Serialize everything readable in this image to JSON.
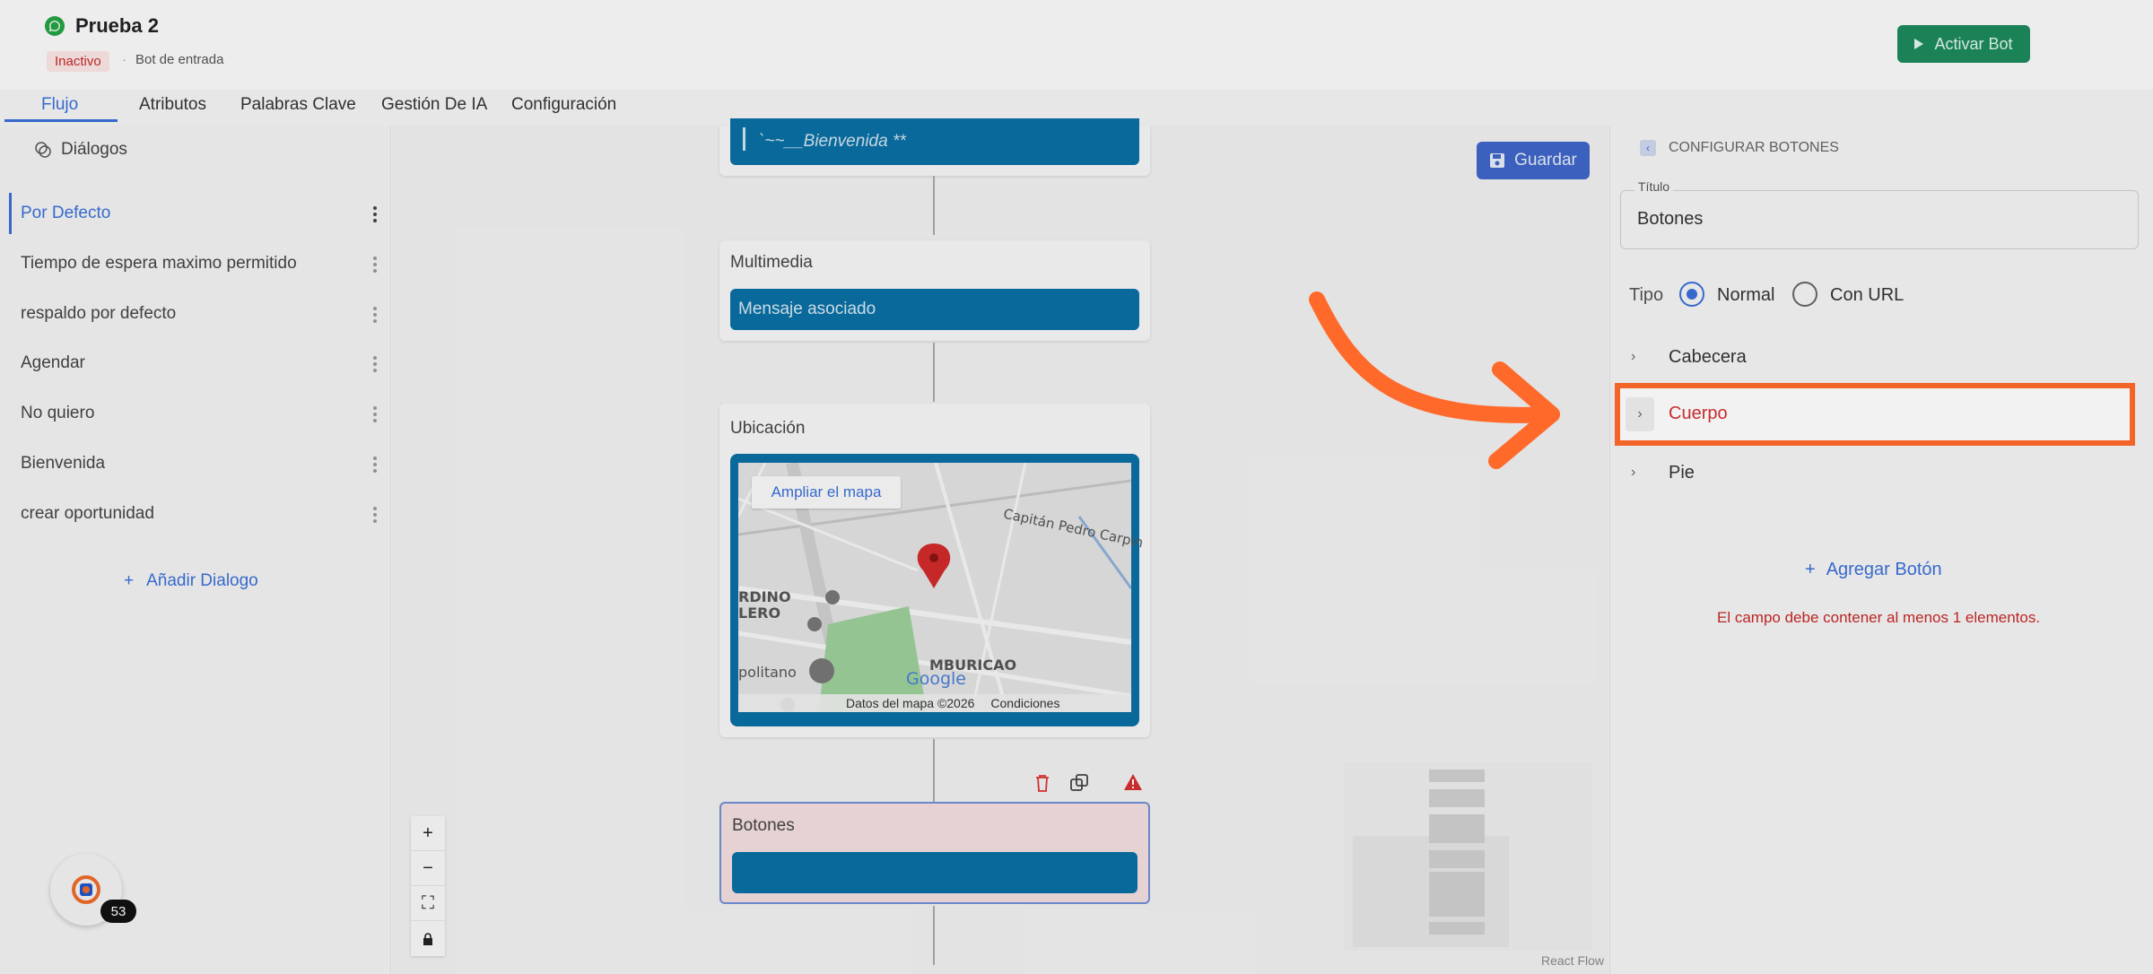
{
  "header": {
    "title": "Prueba 2",
    "status": "Inactivo",
    "separator": "·",
    "bot_type": "Bot de entrada",
    "activate_label": "Activar Bot"
  },
  "tabs": [
    {
      "label": "Flujo",
      "active": true
    },
    {
      "label": "Atributos"
    },
    {
      "label": "Palabras Clave"
    },
    {
      "label": "Gestión De IA"
    },
    {
      "label": "Configuración"
    }
  ],
  "sidebar": {
    "heading": "Diálogos",
    "items": [
      {
        "label": "Por Defecto",
        "active": true
      },
      {
        "label": "Tiempo de espera maximo permitido"
      },
      {
        "label": "respaldo por defecto"
      },
      {
        "label": "Agendar"
      },
      {
        "label": "No quiero"
      },
      {
        "label": "Bienvenida"
      },
      {
        "label": "crear oportunidad"
      }
    ],
    "add_label": "Añadir Dialogo",
    "add_symbol": "+"
  },
  "canvas": {
    "save_label": "Guardar",
    "welcome_text": "`~~__Bienvenida **",
    "multimedia": {
      "title": "Multimedia",
      "bar": "Mensaje asociado"
    },
    "location": {
      "title": "Ubicación",
      "expand_label": "Ampliar el mapa",
      "street_label": "Capitán Pedro Carpin",
      "area_label_1": "RDINO",
      "area_label_2": "LERO",
      "area_label_3": "politano",
      "area_label_4": "MBURICAO",
      "google": "Google",
      "footer_data": "Datos del mapa ©2026",
      "footer_terms": "Condiciones"
    },
    "buttons_node": {
      "title": "Botones"
    },
    "react_flow": "React Flow"
  },
  "panel": {
    "heading": "CONFIGURAR BOTONES",
    "title_label": "Título",
    "title_value": "Botones",
    "type_label": "Tipo",
    "type_options": [
      "Normal",
      "Con URL"
    ],
    "type_selected": "Normal",
    "sections": [
      "Cabecera",
      "Cuerpo",
      "Pie"
    ],
    "add_button_label": "Agregar Botón",
    "add_symbol": "+",
    "error": "El campo debe contener al menos 1 elementos."
  },
  "avatar_badge": "53",
  "colors": {
    "accent": "#3a6fd8",
    "node_bar": "#0b6fa4",
    "activate": "#1d8a5d",
    "highlight": "#ff6a2b",
    "error": "#c62828"
  }
}
